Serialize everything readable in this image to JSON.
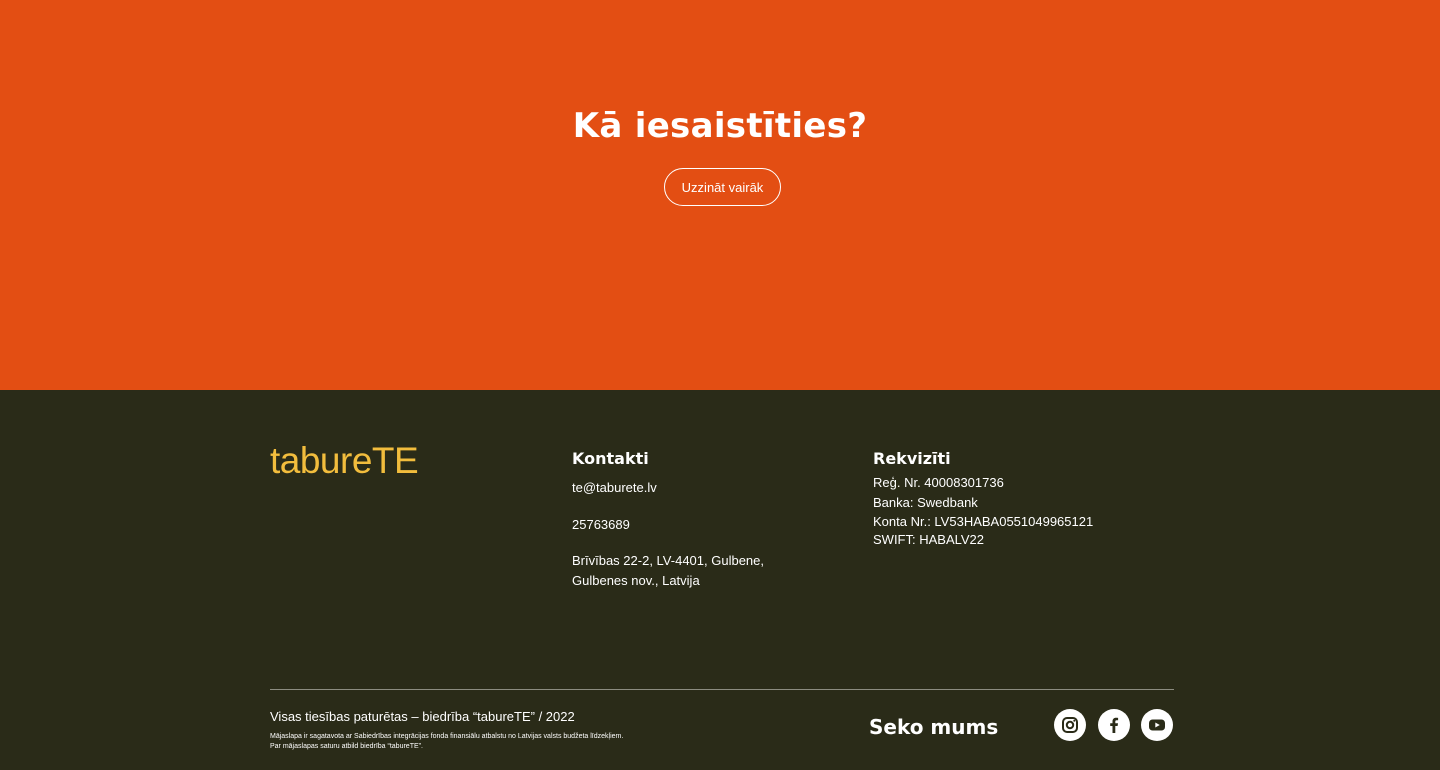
{
  "hero": {
    "title": "Kā iesaistīties?",
    "button_label": "Uzzināt vairāk"
  },
  "footer": {
    "logo": "tabureTE",
    "contacts": {
      "title": "Kontakti",
      "email": "te@taburete.lv",
      "phone": "25763689",
      "address_line1": "Brīvības 22-2, LV-4401, Gulbene,",
      "address_line2": "Gulbenes nov., Latvija"
    },
    "details": {
      "title": "Rekvizīti",
      "reg_no": "Reģ. Nr. 40008301736",
      "bank": "Banka: Swedbank",
      "account": "Konta Nr.: LV53HABA0551049965121",
      "swift": "SWIFT: HABALV22"
    },
    "copyright": "Visas tiesības paturētas – biedrība “tabureTE” / 2022",
    "fineprint_line1": "Mājaslapa ir sagatavota ar Sabiedrības integrācijas fonda finansiālu atbalstu no Latvijas valsts budžeta līdzekļiem.",
    "fineprint_line2": "Par mājaslapas saturu atbild biedrība “tabureTE”.",
    "follow_label": "Seko mums",
    "social": [
      {
        "name": "instagram-icon"
      },
      {
        "name": "facebook-icon"
      },
      {
        "name": "youtube-icon"
      }
    ]
  },
  "colors": {
    "hero_bg": "#e34e13",
    "footer_bg": "#2a2b18",
    "logo": "#f2bd3d"
  }
}
